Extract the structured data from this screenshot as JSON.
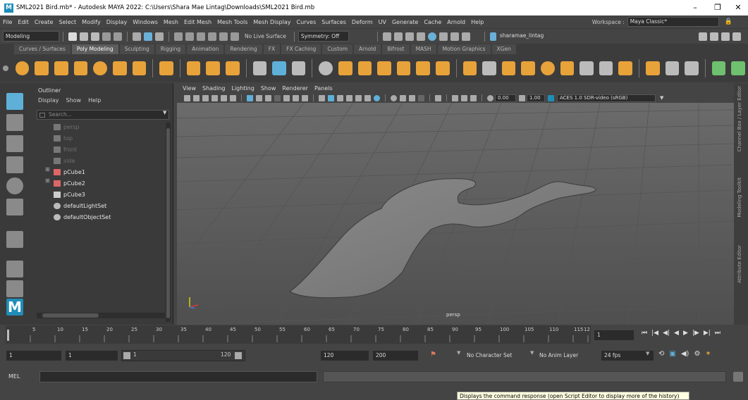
{
  "window": {
    "title": "SML2021 Bird.mb* - Autodesk MAYA 2022: C:\\Users\\Shara Mae Lintag\\Downloads\\SML2021 Bird.mb",
    "minimize": "–",
    "maximize": "❐",
    "close": "✕"
  },
  "menubar": {
    "items": [
      "File",
      "Edit",
      "Create",
      "Select",
      "Modify",
      "Display",
      "Windows",
      "Mesh",
      "Edit Mesh",
      "Mesh Tools",
      "Mesh Display",
      "Curves",
      "Surfaces",
      "Deform",
      "UV",
      "Generate",
      "Cache",
      "Arnold",
      "Help"
    ],
    "workspace_label": "Workspace :",
    "workspace_value": "Maya Classic*"
  },
  "statusline": {
    "mode": "Modeling",
    "live_surface": "No Live Surface",
    "symmetry": "Symmetry: Off",
    "user": "sharamae_lintag"
  },
  "shelf": {
    "tabs": [
      "Curves / Surfaces",
      "Poly Modeling",
      "Sculpting",
      "Rigging",
      "Animation",
      "Rendering",
      "FX",
      "FX Caching",
      "Custom",
      "Arnold",
      "Bifrost",
      "MASH",
      "Motion Graphics",
      "XGen"
    ],
    "active_tab": "Poly Modeling"
  },
  "outliner": {
    "title": "Outliner",
    "menus": [
      "Display",
      "Show",
      "Help"
    ],
    "search_placeholder": "Search...",
    "items": [
      {
        "label": "persp",
        "state": "dim"
      },
      {
        "label": "top",
        "state": "dim"
      },
      {
        "label": "front",
        "state": "dim"
      },
      {
        "label": "side",
        "state": "dim"
      },
      {
        "label": "pCube1",
        "state": "lit"
      },
      {
        "label": "pCube2",
        "state": "lit"
      },
      {
        "label": "pCube3",
        "state": "lit"
      },
      {
        "label": "defaultLightSet",
        "state": "lit"
      },
      {
        "label": "defaultObjectSet",
        "state": "lit"
      }
    ]
  },
  "viewport": {
    "menus": [
      "View",
      "Shading",
      "Lighting",
      "Show",
      "Renderer",
      "Panels"
    ],
    "exposure": "0.00",
    "gamma": "1.00",
    "colorspace": "ACES 1.0 SDR-video (sRGB)",
    "camera": "persp"
  },
  "right_tabs": [
    "Channel Box / Layer Editor",
    "Modeling Toolkit",
    "Attribute Editor"
  ],
  "timeslider": {
    "ticks": [
      "5",
      "10",
      "15",
      "20",
      "25",
      "30",
      "35",
      "40",
      "45",
      "50",
      "55",
      "60",
      "65",
      "70",
      "75",
      "80",
      "85",
      "90",
      "95",
      "100",
      "105",
      "110",
      "115",
      "12"
    ],
    "current_frame": "1"
  },
  "range": {
    "start": "1",
    "anim_start": "1",
    "range_start": "1",
    "range_end": "120",
    "anim_end": "120",
    "end": "200",
    "character_set": "No Character Set",
    "anim_layer": "No Anim Layer",
    "fps": "24 fps"
  },
  "cmdline": {
    "label": "MEL"
  },
  "helpline": {
    "tooltip": "Displays the command response (open Script Editor to display more of the history)"
  },
  "colors": {
    "accent": "#1f8db8",
    "viewport_bg": "#5d5d5d",
    "panel_bg": "#444444"
  }
}
